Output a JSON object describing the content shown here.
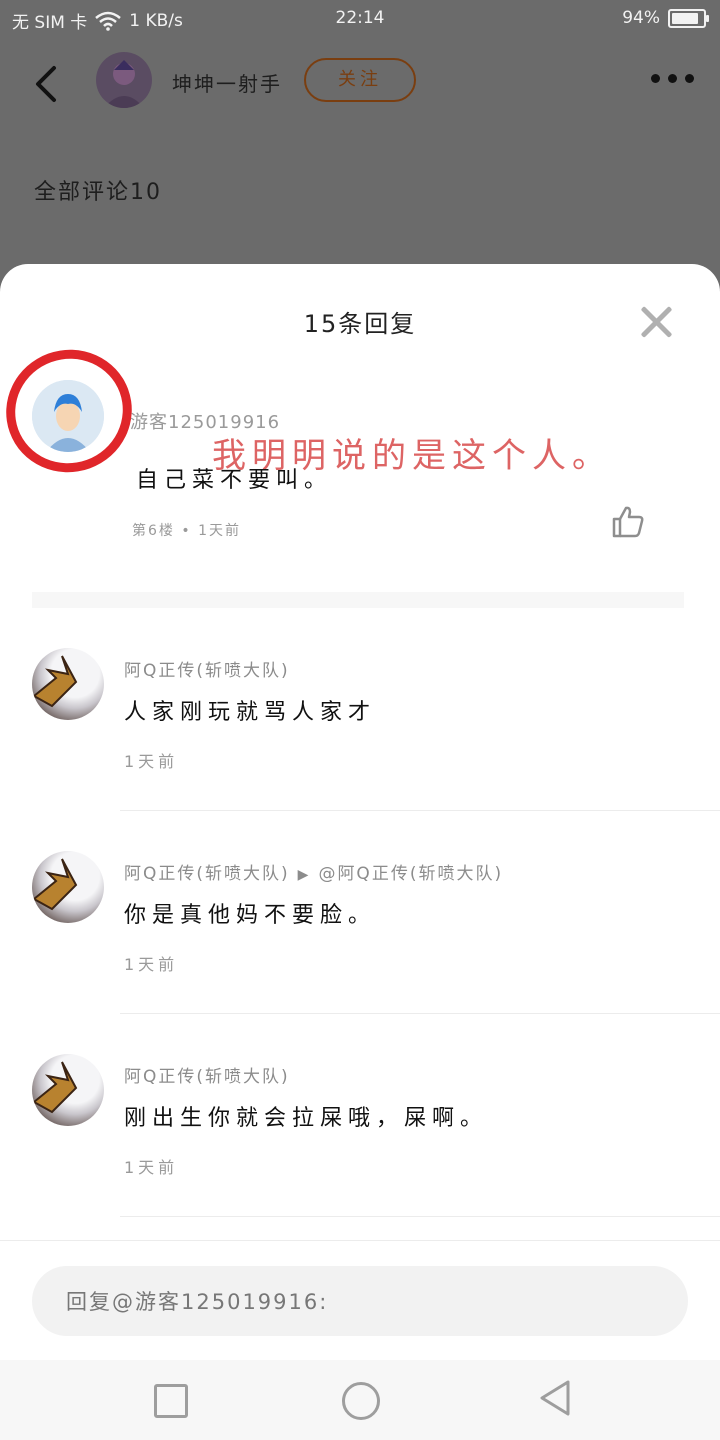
{
  "status_bar": {
    "carrier": "无 SIM 卡",
    "network_speed": "1 KB/s",
    "time": "22:14",
    "battery": "94%",
    "battery_level": 0.94
  },
  "background_page": {
    "username": "坤坤一射手",
    "follow_label": "关注",
    "section_title": "全部评论10"
  },
  "sheet": {
    "title": "15条回复",
    "main_comment": {
      "username": "游客125019916",
      "annotation": "我明明说的是这个人。",
      "text": "自己菜不要叫。",
      "meta": "第6楼 • 1天前"
    },
    "replies": [
      {
        "username": "阿Q正传(斩喷大队)",
        "reply_to": "",
        "text": "人家刚玩就骂人家才",
        "time": "1天前"
      },
      {
        "username": "阿Q正传(斩喷大队)",
        "reply_to": "@阿Q正传(斩喷大队)",
        "text": "你是真他妈不要脸。",
        "time": "1天前"
      },
      {
        "username": "阿Q正传(斩喷大队)",
        "reply_to": "",
        "text": "刚出生你就会拉屎哦，屎啊。",
        "time": "1天前"
      }
    ],
    "reply_input_placeholder": "回复@游客125019916:"
  },
  "icons": {
    "back": "chevron-left-icon",
    "more": "more-dots-icon",
    "close": "close-icon",
    "like": "thumbs-up-icon"
  },
  "colors": {
    "annotation_red": "#e0262a",
    "follow_brown": "#7a3e10"
  }
}
